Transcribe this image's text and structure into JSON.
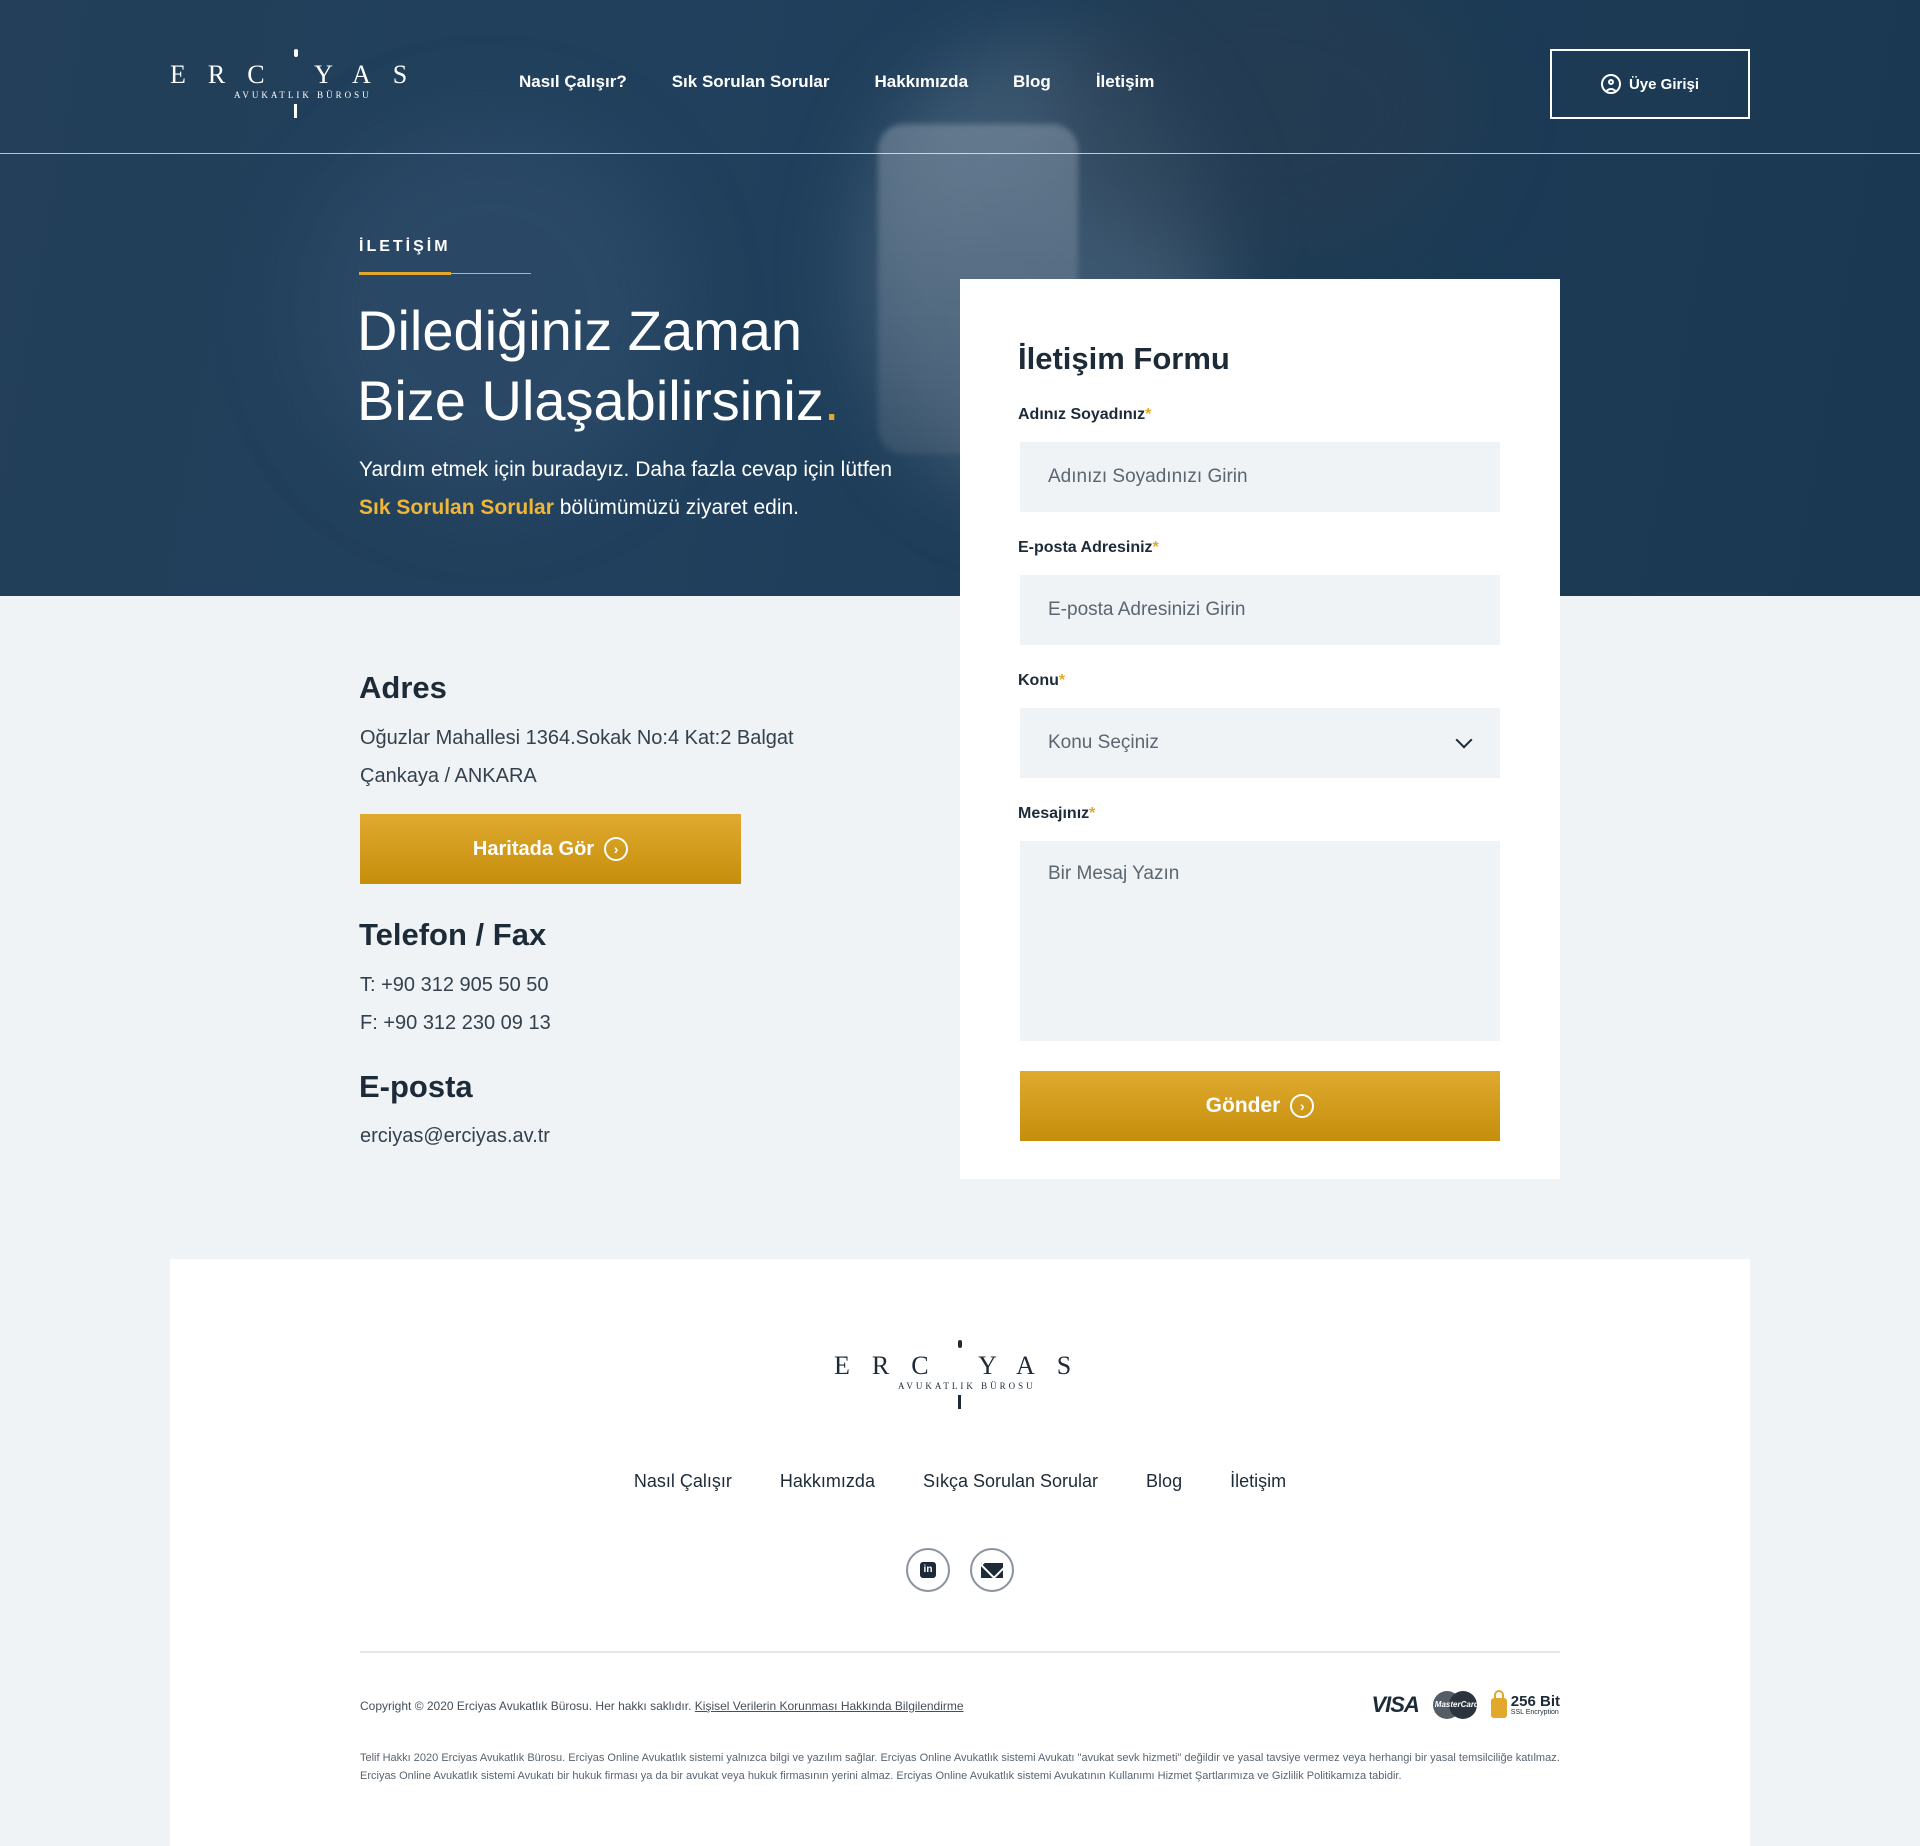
{
  "header": {
    "logo_word": "ERC YAS",
    "logo_sub": "AVUKATLIK BÜROSU",
    "nav": [
      "Nasıl Çalışır?",
      "Sık Sorulan Sorular",
      "Hakkımızda",
      "Blog",
      "İletişim"
    ],
    "login_label": "Üye Girişi"
  },
  "hero": {
    "eyebrow": "İLETİŞİM",
    "title_line1": "Dilediğiniz Zaman",
    "title_line2": "Bize Ulaşabilirsiniz",
    "title_dot": ".",
    "desc_part1": "Yardım etmek için buradayız. Daha fazla cevap için lütfen ",
    "desc_link": "Sık Sorulan Sorular",
    "desc_part2": " bölümümüzü ziyaret edin."
  },
  "contact": {
    "address_heading": "Adres",
    "address_line1": "Oğuzlar Mahallesi 1364.Sokak No:4 Kat:2 Balgat",
    "address_line2": "Çankaya / ANKARA",
    "map_button": "Haritada Gör",
    "phone_heading": "Telefon / Fax",
    "phone": "T: +90 312 905 50 50",
    "fax": "F: +90 312 230 09 13",
    "email_heading": "E-posta",
    "email": "erciyas@erciyas.av.tr"
  },
  "form": {
    "title": "İletişim Formu",
    "name_label": "Adınız Soyadınız",
    "name_placeholder": "Adınızı Soyadınızı Girin",
    "email_label": "E-posta Adresiniz",
    "email_placeholder": "E-posta Adresinizi Girin",
    "subject_label": "Konu",
    "subject_value": "Konu Seçiniz",
    "message_label": "Mesajınız",
    "message_placeholder": "Bir Mesaj Yazın",
    "required_mark": "*",
    "submit": "Gönder"
  },
  "footer": {
    "nav": [
      "Nasıl Çalışır",
      "Hakkımızda",
      "Sıkça Sorulan Sorular",
      "Blog",
      "İletişim"
    ],
    "social": [
      "linkedin-icon",
      "mail-icon"
    ],
    "copyright": "Copyright © 2020 Erciyas Avukatlık Bürosu. Her hakkı saklıdır.",
    "privacy_link": "Kişisel Verilerin Korunması Hakkında Bilgilendirme",
    "legal": "Telif Hakkı 2020 Erciyas Avukatlık Bürosu. Erciyas Online Avukatlık sistemi yalnızca bilgi ve yazılım sağlar. Erciyas Online Avukatlık sistemi Avukatı \"avukat sevk hizmeti\" değildir ve yasal tavsiye vermez veya herhangi bir yasal temsilciliğe katılmaz. Erciyas Online Avukatlık sistemi Avukatı bir hukuk firması ya da bir avukat veya hukuk firmasının yerini almaz. Erciyas Online Avukatlık sistemi Avukatının Kullanımı Hizmet Şartlarımıza ve Gizlilik Politikamıza tabidir.",
    "badges": {
      "visa": "VISA",
      "mastercard": "MasterCard",
      "ssl_big": "256 Bit",
      "ssl_small": "SSL Encryption"
    }
  },
  "colors": {
    "navy": "#1d3c57",
    "gold": "#e2a82c",
    "background": "#eff3f6"
  }
}
